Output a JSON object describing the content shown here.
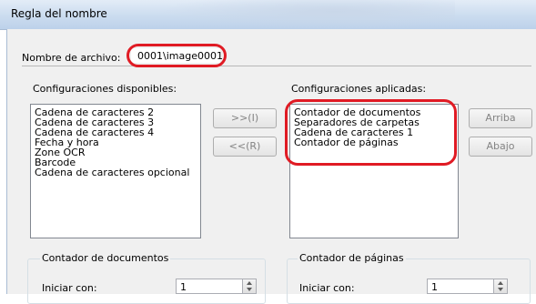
{
  "window": {
    "title": "Regla del nombre"
  },
  "filename": {
    "label": "Nombre de archivo:",
    "value": "0001\\image0001"
  },
  "available": {
    "label": "Configuraciones disponibles:",
    "items": [
      "Cadena de caracteres 2",
      "Cadena de caracteres 3",
      "Cadena de caracteres 4",
      "Fecha y hora",
      "Zone OCR",
      "Barcode",
      "Cadena de caracteres opcional"
    ]
  },
  "applied": {
    "label": "Configuraciones aplicadas:",
    "items": [
      "Contador de documentos",
      "Separadores de carpetas",
      "Cadena de caracteres 1",
      "Contador de páginas"
    ]
  },
  "buttons": {
    "add": ">>(I)",
    "remove": "<<(R)",
    "up": "Arriba",
    "down": "Abajo"
  },
  "doc_counter": {
    "title": "Contador de documentos",
    "start_label": "Iniciar con:",
    "start_value": "1"
  },
  "page_counter": {
    "title": "Contador de páginas",
    "start_label": "Iniciar con:",
    "start_value": "1"
  }
}
